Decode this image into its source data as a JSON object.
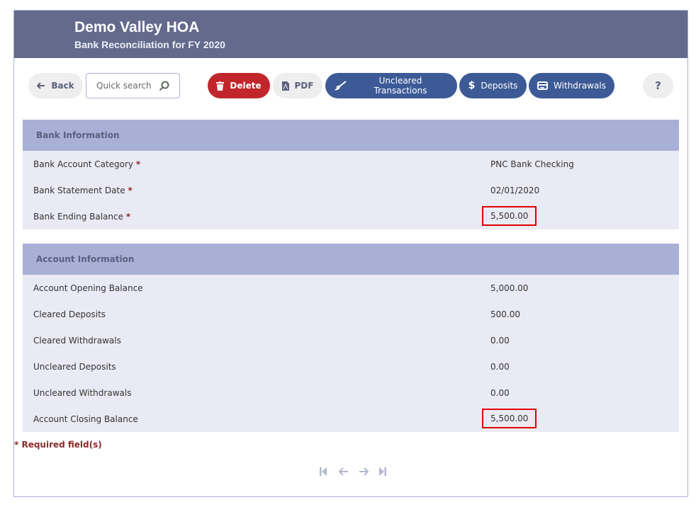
{
  "header": {
    "title": "Demo Valley HOA",
    "subtitle": "Bank Reconciliation for FY 2020"
  },
  "toolbar": {
    "back_label": "Back",
    "search_placeholder": "Quick search",
    "delete_label": "Delete",
    "pdf_label": "PDF",
    "uncleared_label": "Uncleared Transactions",
    "deposits_label": "Deposits",
    "withdrawals_label": "Withdrawals",
    "help_label": "?"
  },
  "bank_info": {
    "title": "Bank Information",
    "rows": [
      {
        "label": "Bank Account Category",
        "required": "*",
        "value": "PNC Bank Checking"
      },
      {
        "label": "Bank Statement Date",
        "required": "*",
        "value": "02/01/2020"
      },
      {
        "label": "Bank Ending Balance",
        "required": "*",
        "value": "5,500.00"
      }
    ]
  },
  "account_info": {
    "title": "Account Information",
    "rows": [
      {
        "label": "Account Opening Balance",
        "value": "5,000.00"
      },
      {
        "label": "Cleared Deposits",
        "value": "500.00"
      },
      {
        "label": "Cleared Withdrawals",
        "value": "0.00"
      },
      {
        "label": "Uncleared Deposits",
        "value": "0.00"
      },
      {
        "label": "Uncleared Withdrawals",
        "value": "0.00"
      },
      {
        "label": "Account Closing Balance",
        "value": "5,500.00"
      }
    ]
  },
  "footer": {
    "required_note": "* Required field(s)",
    "pager": {
      "first": "first-page",
      "prev": "previous-page",
      "next": "next-page",
      "last": "last-page"
    }
  },
  "colors": {
    "header_bg": "#636a8c",
    "section_header_bg": "#a9b0d6",
    "section_body_bg": "#eaeaf4",
    "delete_red": "#c0262b",
    "action_blue": "#3c5a96",
    "highlight_red": "#e00000"
  }
}
